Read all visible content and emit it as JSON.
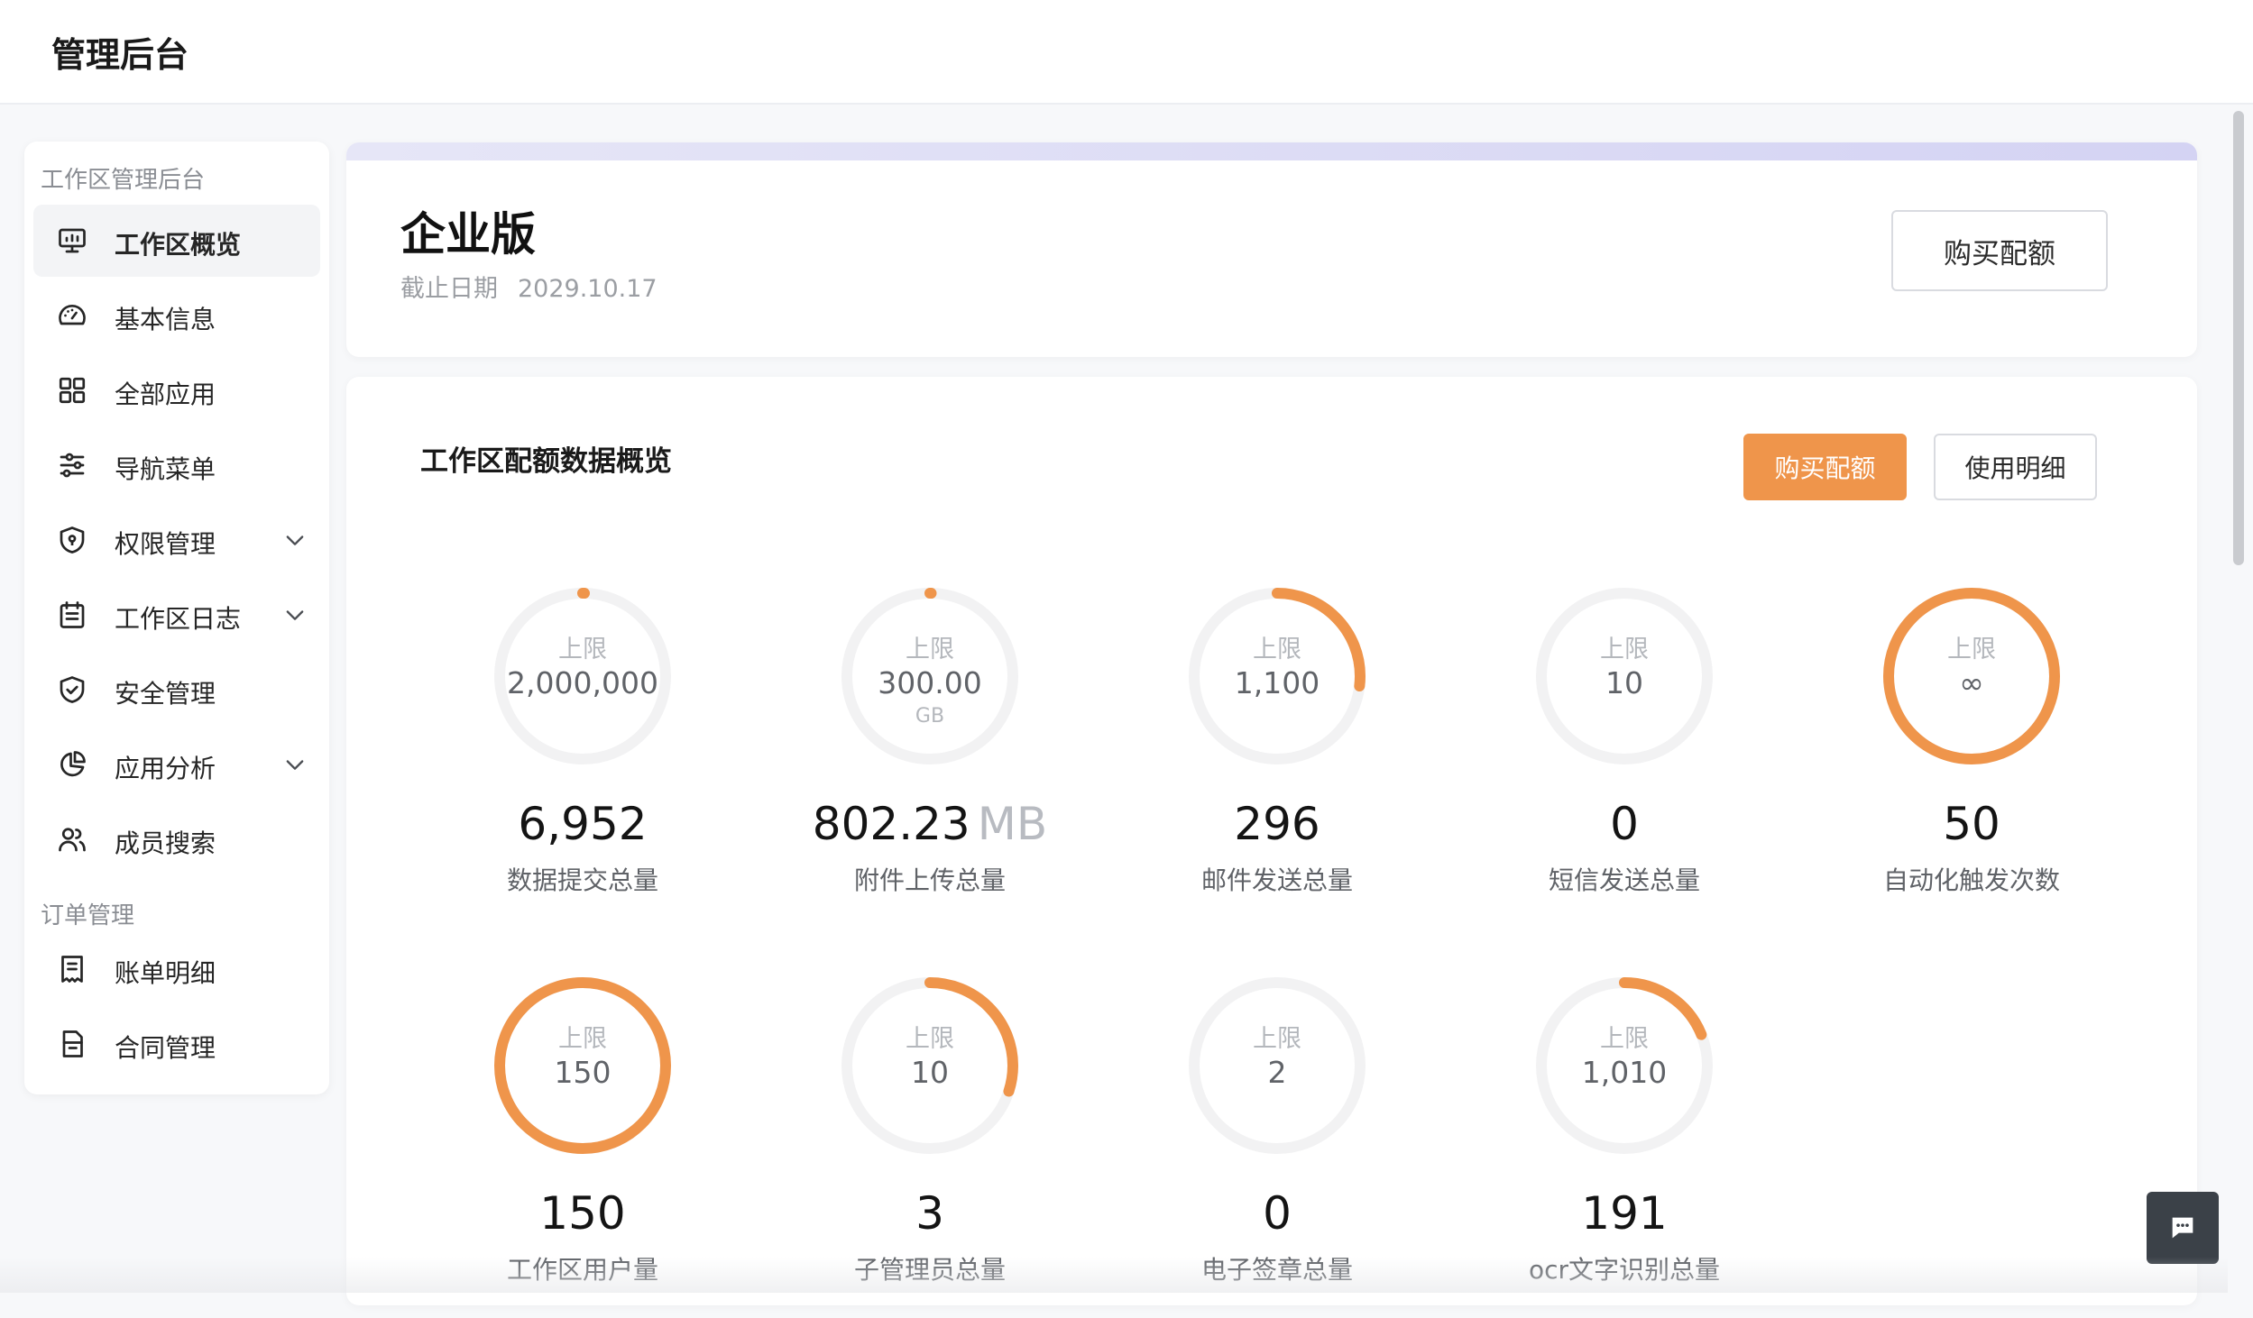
{
  "header": {
    "title": "管理后台"
  },
  "sidebar": {
    "groups": [
      {
        "label": "工作区管理后台"
      },
      {
        "label": "订单管理"
      }
    ],
    "items": [
      {
        "label": "工作区概览",
        "icon": "monitor-icon",
        "active": true
      },
      {
        "label": "基本信息",
        "icon": "dashboard-gauge-icon"
      },
      {
        "label": "全部应用",
        "icon": "grid-icon"
      },
      {
        "label": "导航菜单",
        "icon": "sliders-icon"
      },
      {
        "label": "权限管理",
        "icon": "shield-key-icon",
        "expandable": true
      },
      {
        "label": "工作区日志",
        "icon": "calendar-list-icon",
        "expandable": true
      },
      {
        "label": "安全管理",
        "icon": "shield-check-icon"
      },
      {
        "label": "应用分析",
        "icon": "pie-chart-icon",
        "expandable": true
      },
      {
        "label": "成员搜索",
        "icon": "users-icon"
      },
      {
        "label": "账单明细",
        "icon": "receipt-icon"
      },
      {
        "label": "合同管理",
        "icon": "contract-icon"
      }
    ]
  },
  "plan": {
    "edition": "企业版",
    "expiry_label": "截止日期",
    "expiry_date": "2029.10.17",
    "buy_button": "购买配额"
  },
  "quota": {
    "title": "工作区配额数据概览",
    "buy_button": "购买配额",
    "detail_button": "使用明细",
    "limit_label": "上限",
    "colors": {
      "accent": "#ef954b",
      "track": "#f2f2f3"
    },
    "items": [
      {
        "name": "数据提交总量",
        "value": "6,952",
        "limit": "2,000,000",
        "fraction": 0.0035
      },
      {
        "name": "附件上传总量",
        "value": "802.23",
        "value_unit": "MB",
        "limit": "300.00",
        "limit_unit": "GB",
        "fraction": 0.0026
      },
      {
        "name": "邮件发送总量",
        "value": "296",
        "limit": "1,100",
        "fraction": 0.269
      },
      {
        "name": "短信发送总量",
        "value": "0",
        "limit": "10",
        "fraction": 0
      },
      {
        "name": "自动化触发次数",
        "value": "50",
        "limit": "∞",
        "fraction": 1
      },
      {
        "name": "工作区用户量",
        "value": "150",
        "limit": "150",
        "fraction": 1
      },
      {
        "name": "子管理员总量",
        "value": "3",
        "limit": "10",
        "fraction": 0.3
      },
      {
        "name": "电子签章总量",
        "value": "0",
        "limit": "2",
        "fraction": 0
      },
      {
        "name": "ocr文字识别总量",
        "value": "191",
        "limit": "1,010",
        "fraction": 0.189
      }
    ]
  }
}
